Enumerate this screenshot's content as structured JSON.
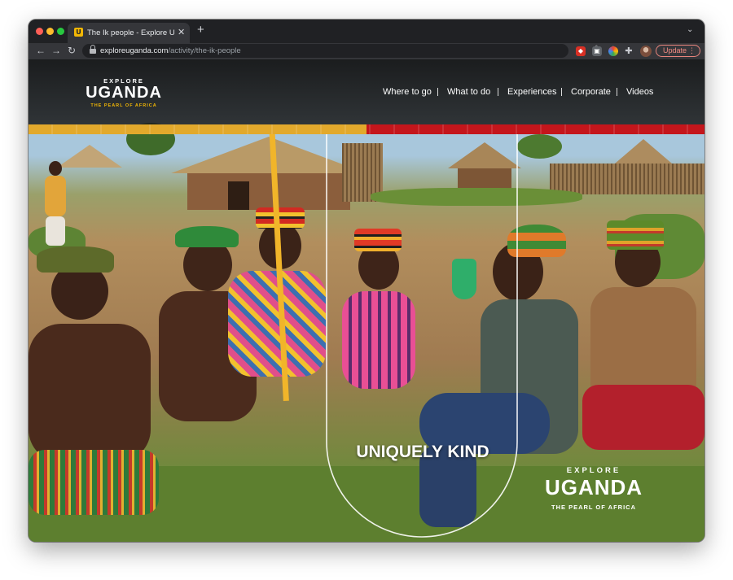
{
  "browser": {
    "tab": {
      "title": "The Ik people - Explore Uganda",
      "favicon_letter": "U"
    },
    "address_bar": {
      "host": "exploreuganda.com",
      "path": "/activity/the-ik-people"
    },
    "update_label": "Update"
  },
  "site": {
    "logo": {
      "explore": "EXPLORE",
      "name": "UGANDA",
      "tagline": "THE PEARL OF AFRICA"
    },
    "nav": [
      {
        "label": "Where to go"
      },
      {
        "label": "What to do"
      },
      {
        "label": "Experiences"
      },
      {
        "label": "Corporate"
      },
      {
        "label": "Videos"
      }
    ]
  },
  "hero": {
    "tagline": "UNIQUELY KIND",
    "corner_logo": {
      "explore": "EXPLORE",
      "name": "UGANDA",
      "tagline": "THE PEARL OF AFRICA"
    }
  },
  "colors": {
    "ribbon_yellow": "#e2a92c",
    "ribbon_red": "#c4161c",
    "brand_gold": "#f2b705"
  }
}
